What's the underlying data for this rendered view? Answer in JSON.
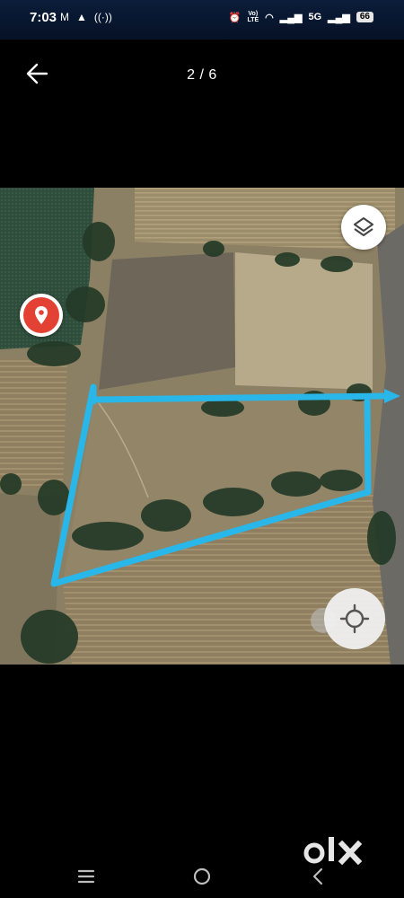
{
  "status_bar": {
    "time": "7:03",
    "network": "5G",
    "battery": "66",
    "volte_label": "VoLTE"
  },
  "header": {
    "counter": "2 / 6"
  },
  "viewer": {
    "route_color": "#29b6e8",
    "icons": [
      "arrow-left-icon",
      "layers-icon",
      "map-pin-icon",
      "compass-icon"
    ]
  },
  "watermark": {
    "brand_text": "olx"
  },
  "nav_bar": {
    "icons": [
      "menu-icon",
      "home-circle-icon",
      "back-chevron-icon"
    ]
  }
}
